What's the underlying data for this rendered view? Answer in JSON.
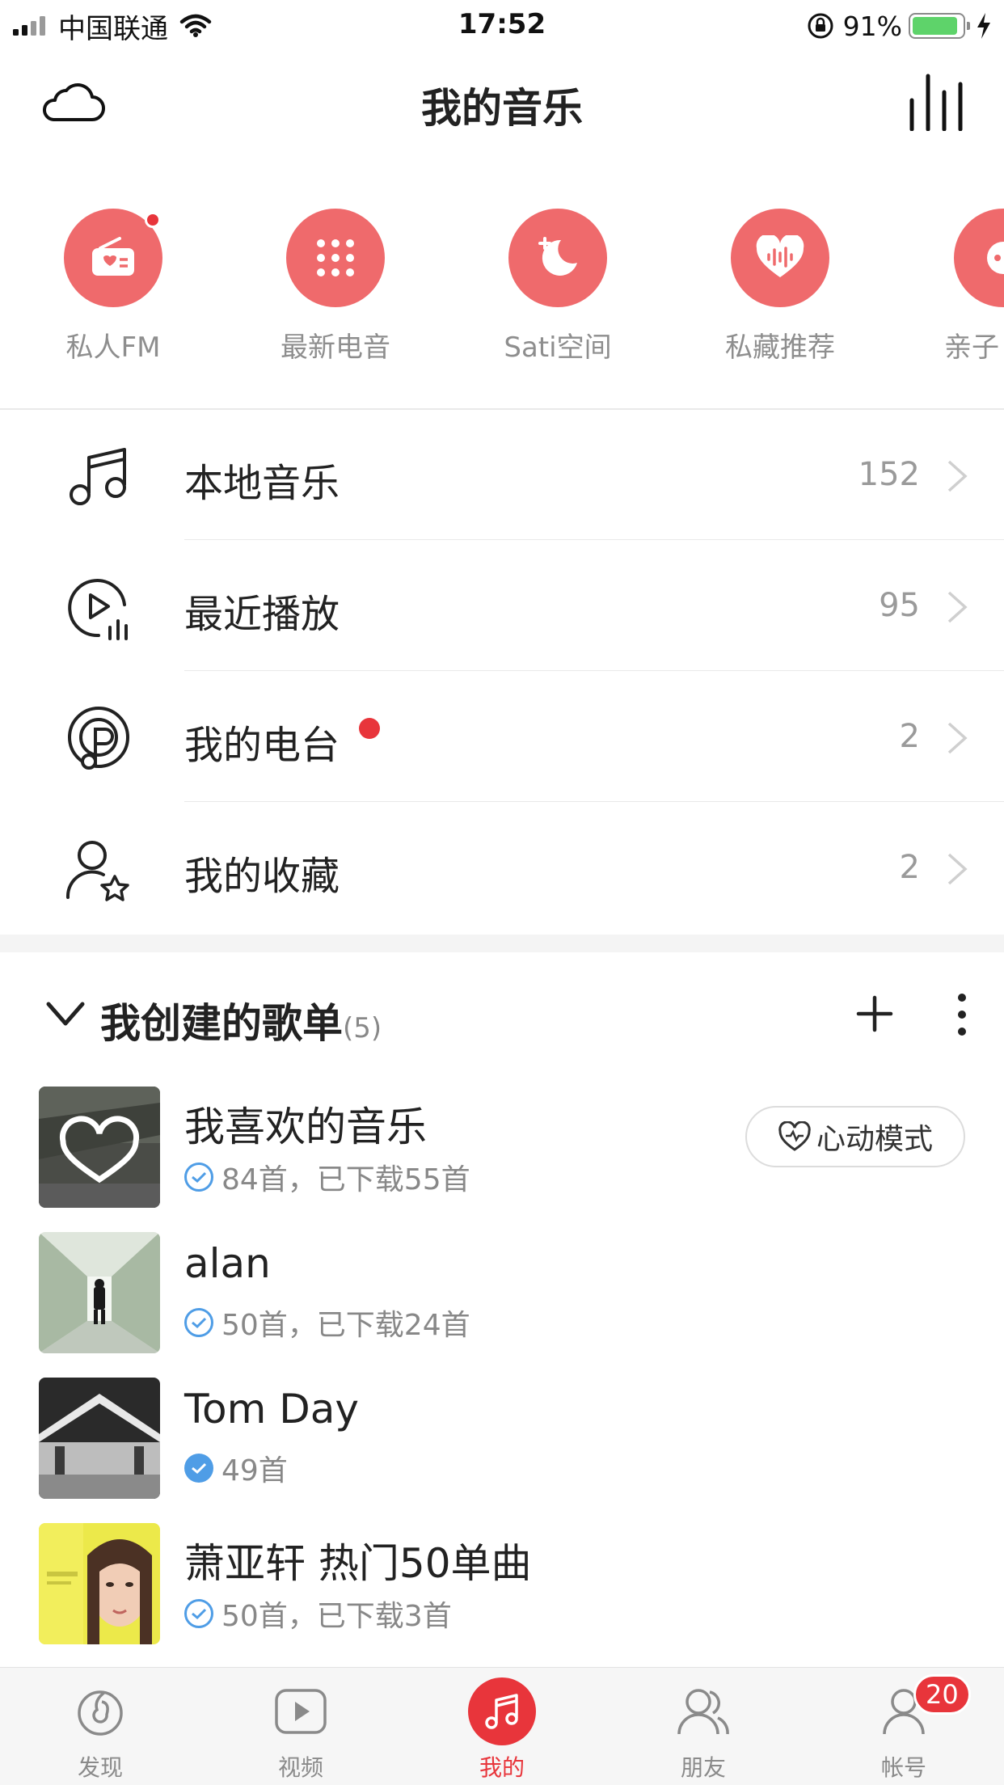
{
  "status_bar": {
    "carrier": "中国联通",
    "time": "17:52",
    "battery_percent": "91%",
    "battery_level": 0.91,
    "icons": [
      "signal-icon",
      "wifi-icon",
      "rotation-lock-icon",
      "battery-icon",
      "charging-icon"
    ]
  },
  "header": {
    "title": "我的音乐",
    "left_icon": "cloud-icon",
    "right_icon": "equalizer-icon"
  },
  "shortcuts": [
    {
      "label": "私人FM",
      "icon": "radio-icon",
      "has_dot": true
    },
    {
      "label": "最新电音",
      "icon": "dots-grid-icon",
      "has_dot": false
    },
    {
      "label": "Sati空间",
      "icon": "moon-icon",
      "has_dot": false
    },
    {
      "label": "私藏推荐",
      "icon": "heart-wave-icon",
      "has_dot": false
    },
    {
      "label": "亲子",
      "icon": "kids-icon",
      "has_dot": false
    }
  ],
  "menu": [
    {
      "label": "本地音乐",
      "count": "152",
      "icon": "music-note-icon"
    },
    {
      "label": "最近播放",
      "count": "95",
      "icon": "recent-play-icon"
    },
    {
      "label": "我的电台",
      "count": "2",
      "icon": "podcast-icon",
      "has_dot": true
    },
    {
      "label": "我的收藏",
      "count": "2",
      "icon": "user-star-icon"
    }
  ],
  "section": {
    "title": "我创建的歌单",
    "count": "(5)"
  },
  "playlists": [
    {
      "name": "我喜欢的音乐",
      "meta": "84首，已下载55首",
      "check": "outline",
      "action": "心动模式"
    },
    {
      "name": "alan",
      "meta": "50首，已下载24首",
      "check": "outline"
    },
    {
      "name": "Tom Day",
      "meta": "49首",
      "check": "filled"
    },
    {
      "name": "萧亚轩 热门50单曲",
      "meta": "50首，已下载3首",
      "check": "outline"
    }
  ],
  "tabbar": [
    {
      "label": "发现",
      "icon": "discover-icon",
      "active": false
    },
    {
      "label": "视频",
      "icon": "video-icon",
      "active": false
    },
    {
      "label": "我的",
      "icon": "music-icon",
      "active": true
    },
    {
      "label": "朋友",
      "icon": "friends-icon",
      "active": false
    },
    {
      "label": "帐号",
      "icon": "account-icon",
      "active": false,
      "badge": "20"
    }
  ],
  "colors": {
    "accent": "#e8353b",
    "shortcut_bg": "#ef6a6c",
    "check_blue": "#4f9de6",
    "battery_green": "#5ed36a"
  }
}
